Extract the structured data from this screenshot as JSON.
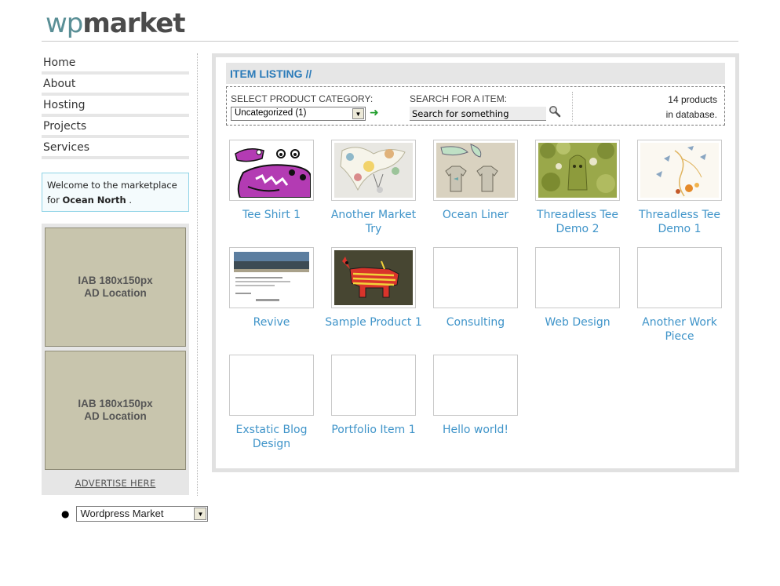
{
  "header": {
    "logo_part1": "wp",
    "logo_part2": "market"
  },
  "sidebar": {
    "nav": [
      {
        "label": "Home"
      },
      {
        "label": "About"
      },
      {
        "label": "Hosting"
      },
      {
        "label": "Projects"
      },
      {
        "label": "Services"
      }
    ],
    "welcome_text": "Welcome to the marketplace for",
    "welcome_name": "Ocean North",
    "welcome_end": ".",
    "ads": [
      {
        "line1": "IAB 180x150px",
        "line2": "AD Location"
      },
      {
        "line1": "IAB 180x150px",
        "line2": "AD Location"
      }
    ],
    "advertise_link": "ADVERTISE HERE",
    "blog_select": "Wordpress Market"
  },
  "main": {
    "heading": "ITEM LISTING //",
    "category_label": "SELECT PRODUCT CATEGORY:",
    "category_value": "Uncategorized  (1)",
    "search_label": "SEARCH FOR A ITEM:",
    "search_value": "Search for something",
    "count_line1": "14 products",
    "count_line2": "in database.",
    "items": [
      {
        "title": "Tee Shirt 1",
        "thumb": "monster"
      },
      {
        "title": "Another Market Try",
        "thumb": "sketch"
      },
      {
        "title": "Ocean Liner",
        "thumb": "tees"
      },
      {
        "title": "Threadless Tee Demo 2",
        "thumb": "forest"
      },
      {
        "title": "Threadless Tee Demo 1",
        "thumb": "birds"
      },
      {
        "title": "Revive",
        "thumb": "screenshot"
      },
      {
        "title": "Sample Product 1",
        "thumb": "pinata"
      },
      {
        "title": "Consulting",
        "thumb": "blank"
      },
      {
        "title": "Web Design",
        "thumb": "blank"
      },
      {
        "title": "Another Work Piece",
        "thumb": "blank"
      },
      {
        "title": "Exstatic Blog Design",
        "thumb": "blank"
      },
      {
        "title": "Portfolio Item 1",
        "thumb": "blank"
      },
      {
        "title": "Hello world!",
        "thumb": "blank"
      }
    ]
  },
  "colors": {
    "link": "#3f94c9",
    "heading": "#2b7bb9",
    "ad_bg": "#c8c5ad"
  }
}
